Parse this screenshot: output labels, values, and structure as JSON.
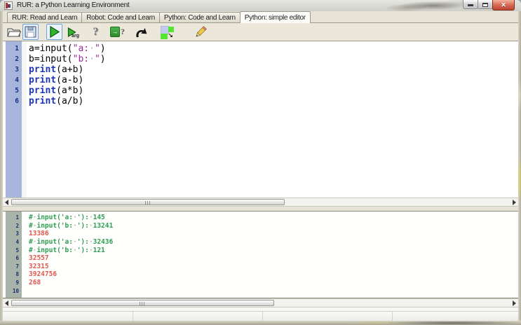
{
  "window": {
    "title": "RUR: a Python Learning Environment",
    "controls": [
      {
        "name": "minimize"
      },
      {
        "name": "maximize"
      },
      {
        "name": "close"
      }
    ]
  },
  "tabs": [
    {
      "label": "RUR: Read and Learn",
      "active": false
    },
    {
      "label": "Robot: Code and Learn",
      "active": false
    },
    {
      "label": "Python: Code and Learn",
      "active": false
    },
    {
      "label": "Python: simple editor",
      "active": true
    }
  ],
  "toolbar": {
    "items": [
      {
        "name": "open-file",
        "icon": "folder-open-icon",
        "label": ""
      },
      {
        "name": "save-file",
        "icon": "save-floppy-icon",
        "label": "",
        "highlighted": true
      },
      {
        "name": "run-program",
        "icon": "run-play-icon",
        "label": "",
        "highlighted": true
      },
      {
        "name": "run-with-args",
        "icon": "run-args-icon",
        "label": "arg"
      },
      {
        "name": "help",
        "icon": "help-icon",
        "label": "?"
      },
      {
        "name": "context-help",
        "icon": "context-help-icon",
        "label": "?"
      },
      {
        "name": "undo",
        "icon": "undo-arrow-icon",
        "label": ""
      },
      {
        "name": "layout-toggle",
        "icon": "layout-squares-icon",
        "label": ""
      },
      {
        "name": "edit-mode",
        "icon": "pencil-icon",
        "label": ""
      }
    ]
  },
  "editor": {
    "lines": [
      {
        "num": 1,
        "tokens": [
          {
            "t": "a=input(",
            "c": "p"
          },
          {
            "t": "\"a: \"",
            "c": "s"
          },
          {
            "t": ")",
            "c": "p"
          }
        ]
      },
      {
        "num": 2,
        "tokens": [
          {
            "t": "b=input(",
            "c": "p"
          },
          {
            "t": "\"b: \"",
            "c": "s"
          },
          {
            "t": ")",
            "c": "p"
          }
        ]
      },
      {
        "num": 3,
        "tokens": [
          {
            "t": "print",
            "c": "k"
          },
          {
            "t": "(a+b)",
            "c": "p"
          }
        ]
      },
      {
        "num": 4,
        "tokens": [
          {
            "t": "print",
            "c": "k"
          },
          {
            "t": "(a-b)",
            "c": "p"
          }
        ]
      },
      {
        "num": 5,
        "tokens": [
          {
            "t": "print",
            "c": "k"
          },
          {
            "t": "(a*b)",
            "c": "p"
          }
        ]
      },
      {
        "num": 6,
        "tokens": [
          {
            "t": "print",
            "c": "k"
          },
          {
            "t": "(a/b)",
            "c": "p"
          }
        ]
      }
    ]
  },
  "output": {
    "lines": [
      {
        "num": 1,
        "text": "# input('a: '): 145",
        "style": "comment"
      },
      {
        "num": 2,
        "text": "# input('b: '): 13241",
        "style": "comment"
      },
      {
        "num": 3,
        "text": "13386",
        "style": "result"
      },
      {
        "num": 4,
        "text": "# input('a: '): 32436",
        "style": "comment"
      },
      {
        "num": 5,
        "text": "# input('b: '): 121",
        "style": "comment"
      },
      {
        "num": 6,
        "text": "32557",
        "style": "result"
      },
      {
        "num": 7,
        "text": "32315",
        "style": "result"
      },
      {
        "num": 8,
        "text": "3924756",
        "style": "result"
      },
      {
        "num": 9,
        "text": "268",
        "style": "result"
      },
      {
        "num": 10,
        "text": "",
        "style": "result"
      }
    ]
  },
  "scrollbars": {
    "editor_thumb_percent": 53,
    "output_thumb_percent": 51
  },
  "statusbar": {
    "panes": [
      "",
      "",
      "",
      ""
    ]
  },
  "colors": {
    "keyword": "#1c35b5",
    "string": "#9b2d9b",
    "output_comment_green": "#2f9e53",
    "output_result_red": "#e0574f",
    "editor_gutter": "#a7b4dc",
    "output_gutter": "#a8b4a9",
    "run_highlight_border": "#6fa3d7",
    "close_button_red": "#bf4432"
  }
}
